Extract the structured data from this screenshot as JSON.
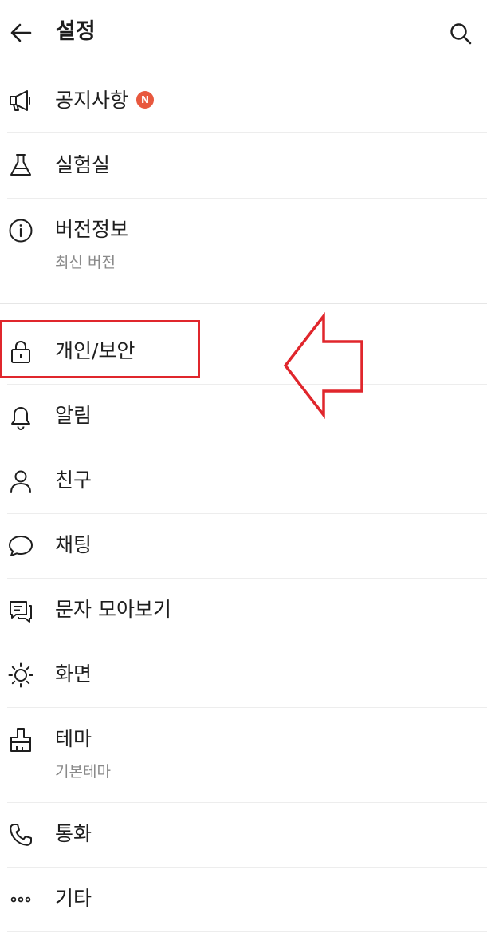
{
  "header": {
    "title": "설정"
  },
  "menu": {
    "items": [
      {
        "id": "notice",
        "label": "공지사항",
        "icon": "megaphone-icon",
        "badge": "N"
      },
      {
        "id": "lab",
        "label": "실험실",
        "icon": "flask-icon"
      },
      {
        "id": "version",
        "label": "버전정보",
        "sub": "최신 버전",
        "icon": "info-icon"
      },
      {
        "id": "privacy",
        "label": "개인/보안",
        "icon": "lock-icon"
      },
      {
        "id": "notifications",
        "label": "알림",
        "icon": "bell-icon"
      },
      {
        "id": "friends",
        "label": "친구",
        "icon": "person-icon"
      },
      {
        "id": "chat",
        "label": "채팅",
        "icon": "chat-bubble-icon"
      },
      {
        "id": "sms",
        "label": "문자 모아보기",
        "icon": "message-icon"
      },
      {
        "id": "display",
        "label": "화면",
        "icon": "brightness-icon"
      },
      {
        "id": "theme",
        "label": "테마",
        "sub": "기본테마",
        "icon": "paint-brush-icon"
      },
      {
        "id": "call",
        "label": "통화",
        "icon": "phone-icon"
      },
      {
        "id": "etc",
        "label": "기타",
        "icon": "more-icon"
      }
    ]
  },
  "colors": {
    "text": "#1e1e1e",
    "subtext": "#8a8a8a",
    "badge": "#e8583e",
    "highlight": "#e0262c",
    "divider": "#ededed"
  }
}
